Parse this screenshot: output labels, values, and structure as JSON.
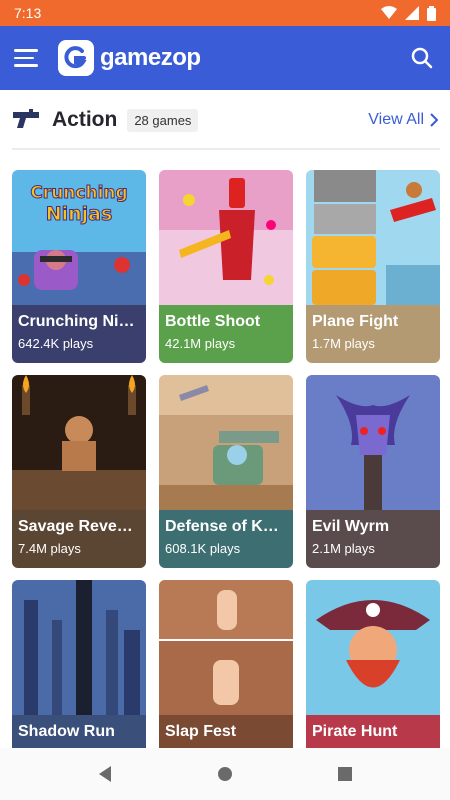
{
  "status": {
    "time": "7:13"
  },
  "header": {
    "brand": "gamezop"
  },
  "section": {
    "title": "Action",
    "count": "28 games",
    "view_all": "View All"
  },
  "games": [
    {
      "title": "Crunching Ninjas",
      "plays": "642.4K plays",
      "color": "#3b3f6e"
    },
    {
      "title": "Bottle Shoot",
      "plays": "42.1M plays",
      "color": "#5ba04a"
    },
    {
      "title": "Plane Fight",
      "plays": "1.7M plays",
      "color": "#b49a72"
    },
    {
      "title": "Savage Revenge",
      "plays": "7.4M plays",
      "color": "#5a4632"
    },
    {
      "title": "Defense of Kazan",
      "plays": "608.1K plays",
      "color": "#3d6f72"
    },
    {
      "title": "Evil Wyrm",
      "plays": "2.1M plays",
      "color": "#5a4c4c"
    },
    {
      "title": "Shadow Run",
      "plays": "",
      "color": "#3a4f7a"
    },
    {
      "title": "Slap Fest",
      "plays": "",
      "color": "#7a4a33"
    },
    {
      "title": "Pirate Hunt",
      "plays": "",
      "color": "#b83a4a"
    }
  ]
}
